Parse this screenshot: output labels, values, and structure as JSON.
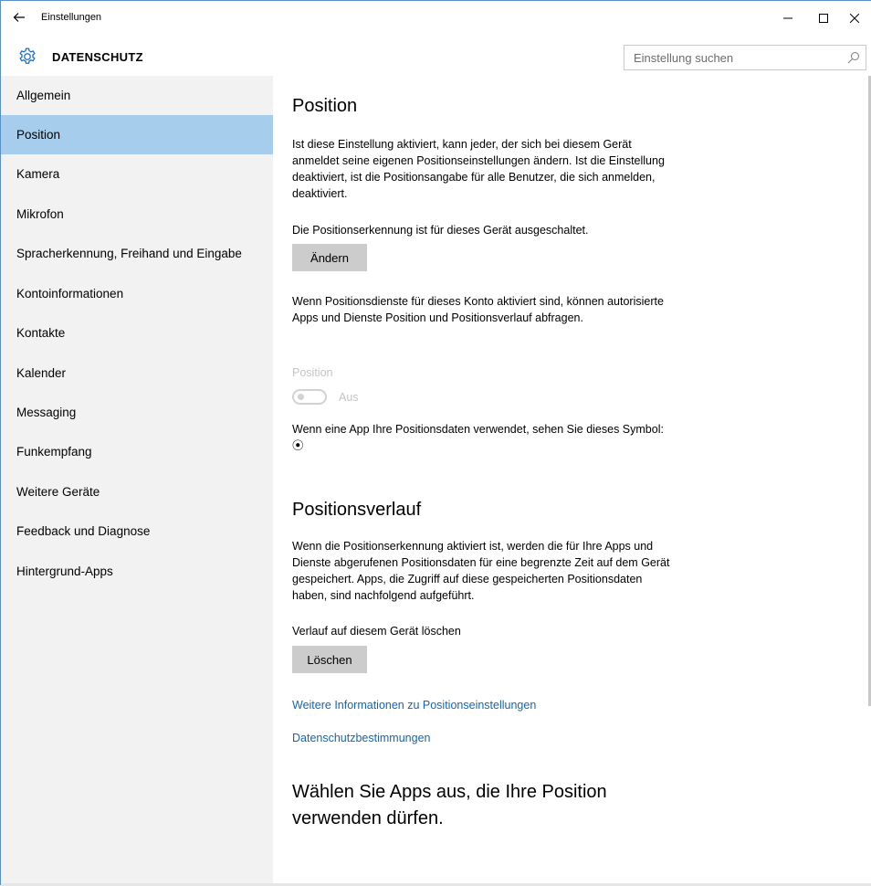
{
  "window": {
    "title": "Einstellungen",
    "minimize_glyph": "–",
    "maximize_glyph": "☐",
    "close_glyph": "✕"
  },
  "header": {
    "title": "DATENSCHUTZ",
    "search_placeholder": "Einstellung suchen"
  },
  "sidebar": {
    "items": [
      {
        "label": "Allgemein",
        "selected": false
      },
      {
        "label": "Position",
        "selected": true
      },
      {
        "label": "Kamera",
        "selected": false
      },
      {
        "label": "Mikrofon",
        "selected": false
      },
      {
        "label": "Spracherkennung, Freihand und Eingabe",
        "selected": false
      },
      {
        "label": "Kontoinformationen",
        "selected": false
      },
      {
        "label": "Kontakte",
        "selected": false
      },
      {
        "label": "Kalender",
        "selected": false
      },
      {
        "label": "Messaging",
        "selected": false
      },
      {
        "label": "Funkempfang",
        "selected": false
      },
      {
        "label": "Weitere Geräte",
        "selected": false
      },
      {
        "label": "Feedback und Diagnose",
        "selected": false
      },
      {
        "label": "Hintergrund-Apps",
        "selected": false
      }
    ]
  },
  "main": {
    "position_heading": "Position",
    "position_intro": "Ist diese Einstellung aktiviert, kann jeder, der sich bei diesem Gerät anmeldet seine eigenen Positionseinstellungen ändern. Ist die Einstellung deaktiviert, ist die Positionsangabe für alle Benutzer, die sich anmelden, deaktiviert.",
    "device_status": "Die Positionserkennung ist für dieses Gerät ausgeschaltet.",
    "change_button": "Ändern",
    "account_info": "Wenn Positionsdienste für dieses Konto aktiviert sind, können autorisierte Apps und Dienste Position und Positionsverlauf abfragen.",
    "toggle_label": "Position",
    "toggle_state": "Aus",
    "toggle_on": false,
    "toggle_enabled": false,
    "symbol_info": "Wenn eine App Ihre Positionsdaten verwendet, sehen Sie dieses Symbol: ⦿",
    "history_heading": "Positionsverlauf",
    "history_text": "Wenn die Positionserkennung aktiviert ist, werden die für Ihre Apps und Dienste abgerufenen Positionsdaten für eine begrenzte Zeit auf dem Gerät gespeichert. Apps, die Zugriff auf diese gespeicherten Positionsdaten haben, sind nachfolgend aufgeführt.",
    "clear_label": "Verlauf auf diesem Gerät löschen",
    "clear_button": "Löschen",
    "link_more_info": "Weitere Informationen zu Positionseinstellungen",
    "link_privacy": "Datenschutzbestimmungen",
    "apps_heading": "Wählen Sie Apps aus, die Ihre Position verwenden dürfen."
  },
  "colors": {
    "accent_selected": "#a6cdeb",
    "sidebar_bg": "#f2f2f2",
    "link": "#1565b6",
    "button_bg": "#cccccc"
  }
}
